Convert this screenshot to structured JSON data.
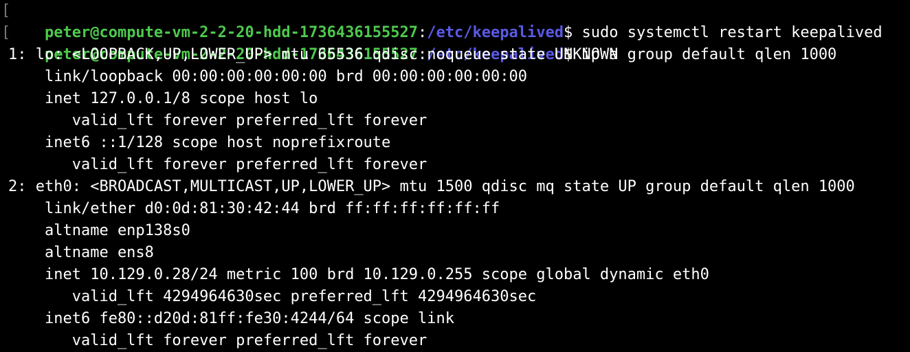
{
  "prompt": {
    "bracket": "[",
    "user_host": "peter@compute-vm-2-2-20-hdd-1736436155527",
    "separator": ":",
    "cwd": "/etc/keepalived",
    "symbol": "$"
  },
  "commands": [
    " sudo systemctl restart keepalived",
    " ip a"
  ],
  "output": [
    "1: lo: <LOOPBACK,UP,LOWER_UP> mtu 65536 qdisc noqueue state UNKNOWN group default qlen 1000",
    "    link/loopback 00:00:00:00:00:00 brd 00:00:00:00:00:00",
    "    inet 127.0.0.1/8 scope host lo",
    "       valid_lft forever preferred_lft forever",
    "    inet6 ::1/128 scope host noprefixroute",
    "       valid_lft forever preferred_lft forever",
    "2: eth0: <BROADCAST,MULTICAST,UP,LOWER_UP> mtu 1500 qdisc mq state UP group default qlen 1000",
    "    link/ether d0:0d:81:30:42:44 brd ff:ff:ff:ff:ff:ff",
    "    altname enp138s0",
    "    altname ens8",
    "    inet 10.129.0.28/24 metric 100 brd 10.129.0.255 scope global dynamic eth0",
    "       valid_lft 4294964630sec preferred_lft 4294964630sec",
    "    inet6 fe80::d20d:81ff:fe30:4244/64 scope link",
    "       valid_lft forever preferred_lft forever"
  ],
  "colors": {
    "background": "#000000",
    "user_host": "#4ec94e",
    "cwd": "#5a5ae6",
    "text": "#ffffff"
  }
}
